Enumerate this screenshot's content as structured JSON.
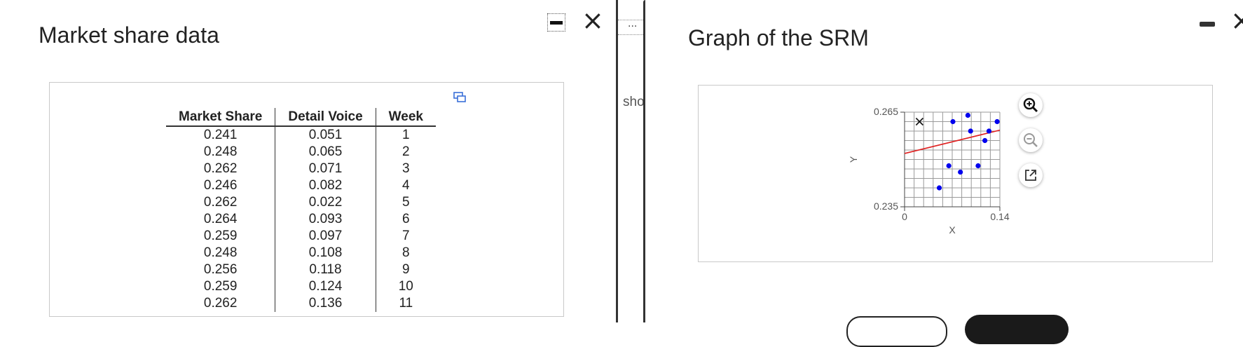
{
  "left_panel": {
    "title": "Market share data",
    "table": {
      "headers": [
        "Market Share",
        "Detail Voice",
        "Week"
      ],
      "rows": [
        [
          "0.241",
          "0.051",
          "1"
        ],
        [
          "0.248",
          "0.065",
          "2"
        ],
        [
          "0.262",
          "0.071",
          "3"
        ],
        [
          "0.246",
          "0.082",
          "4"
        ],
        [
          "0.262",
          "0.022",
          "5"
        ],
        [
          "0.264",
          "0.093",
          "6"
        ],
        [
          "0.259",
          "0.097",
          "7"
        ],
        [
          "0.248",
          "0.108",
          "8"
        ],
        [
          "0.256",
          "0.118",
          "9"
        ],
        [
          "0.259",
          "0.124",
          "10"
        ],
        [
          "0.262",
          "0.136",
          "11"
        ]
      ]
    },
    "close_symbol": "×"
  },
  "middle": {
    "more_dots": "...",
    "clipped_text": "sho"
  },
  "right_panel": {
    "title": "Graph of the SRM",
    "close_symbol": "×",
    "icons": {
      "zoom_in": "zoom-in-icon",
      "zoom_out": "zoom-out-icon",
      "popout": "popout-icon"
    }
  },
  "chart_data": {
    "type": "scatter",
    "title": "",
    "xlabel": "X",
    "ylabel": "Y",
    "xlim": [
      0,
      0.14
    ],
    "ylim": [
      0.235,
      0.265
    ],
    "x_tick_labels": [
      "0",
      "0.14"
    ],
    "y_tick_labels": [
      "0.265",
      "0.235"
    ],
    "grid": true,
    "point_color": "#0000ee",
    "line_color": "#e02020",
    "points": [
      {
        "x": 0.051,
        "y": 0.241
      },
      {
        "x": 0.065,
        "y": 0.248
      },
      {
        "x": 0.071,
        "y": 0.262
      },
      {
        "x": 0.082,
        "y": 0.246
      },
      {
        "x": 0.093,
        "y": 0.264
      },
      {
        "x": 0.097,
        "y": 0.259
      },
      {
        "x": 0.108,
        "y": 0.248
      },
      {
        "x": 0.118,
        "y": 0.256
      },
      {
        "x": 0.124,
        "y": 0.259
      },
      {
        "x": 0.136,
        "y": 0.262
      }
    ],
    "outlier": {
      "x": 0.022,
      "y": 0.262
    },
    "fit_line": {
      "x": [
        0,
        0.14
      ],
      "y": [
        0.2519,
        0.2593
      ]
    }
  }
}
